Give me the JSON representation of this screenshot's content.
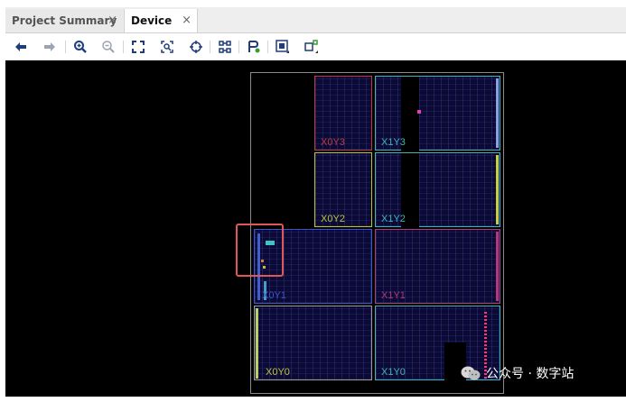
{
  "tabs": [
    {
      "label": "Project Summary",
      "close": "×"
    },
    {
      "label": "Device",
      "close": "×"
    }
  ],
  "toolbar": {
    "icons": [
      "back-icon",
      "forward-icon",
      "zoom-in-icon",
      "zoom-out-icon",
      "fit-icon",
      "zoom-area-icon",
      "target-icon",
      "route-icon",
      "place-icon",
      "device-view-icon",
      "select-icon"
    ]
  },
  "regions": [
    {
      "label": "X0Y3",
      "color": "#c0393b"
    },
    {
      "label": "X1Y3",
      "color": "#3fb4b4"
    },
    {
      "label": "X0Y2",
      "color": "#b8c23a"
    },
    {
      "label": "X1Y2",
      "color": "#3fb4b4"
    },
    {
      "label": "X0Y1",
      "color": "#3a55d0"
    },
    {
      "label": "X1Y1",
      "color": "#b03a7a"
    },
    {
      "label": "X0Y0",
      "color": "#b8c23a"
    },
    {
      "label": "X1Y0",
      "color": "#3fb4b4"
    }
  ],
  "watermark": "公众号 · 数字站"
}
